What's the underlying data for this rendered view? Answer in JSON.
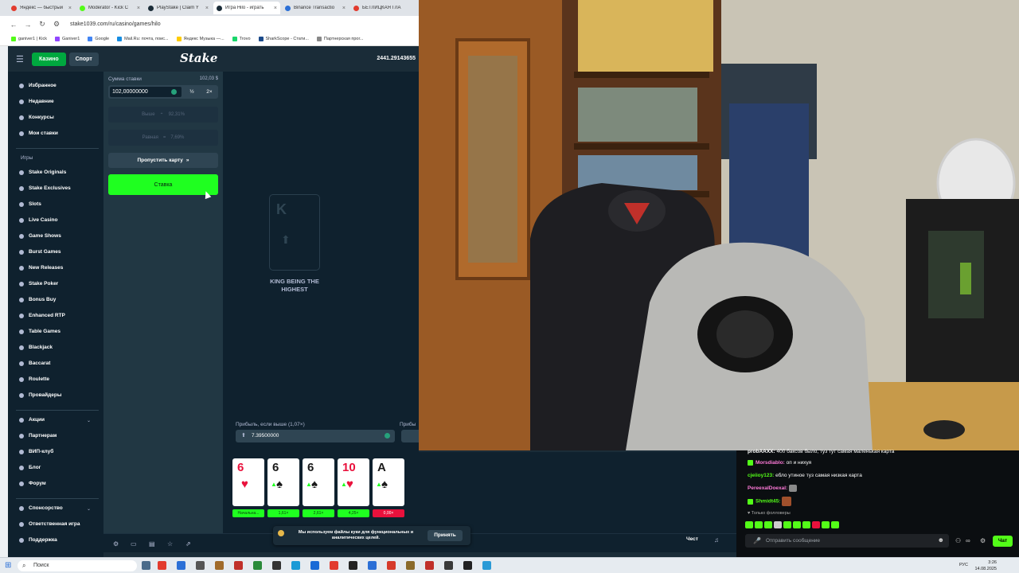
{
  "browser": {
    "tabs": [
      {
        "label": "Яндекс — быстрый",
        "color": "#e23b2e"
      },
      {
        "label": "Moderator - Kick C",
        "color": "#53fc18"
      },
      {
        "label": "PlayStake | Claim Y",
        "color": "#1a2c38"
      },
      {
        "label": "Игра Hilo - играть",
        "color": "#1a2c38"
      },
      {
        "label": "Binance Transactio",
        "color": "#2b6fd6"
      },
      {
        "label": "БЕТЛИЦКАЯ ГЛА",
        "color": "#e23b2e"
      }
    ],
    "url": "stake1039.com/ru/casino/games/hilo",
    "bookmarks": [
      "ganiver1 | Kick",
      "Ganiver1",
      "Google",
      "Mail.Ru: почта, поис...",
      "Яндекс Музыка —...",
      "Trovo",
      "SharkScope - Стати...",
      "Партнерская прог..."
    ]
  },
  "header": {
    "casino": "Казино",
    "sport": "Спорт",
    "logo": "Stake",
    "balance": "2441.29143655"
  },
  "sidebar": {
    "top_items": [
      "Избранное",
      "Недавние",
      "Конкурсы",
      "Мои ставки"
    ],
    "games_title": "Игры",
    "game_items": [
      "Stake Originals",
      "Stake Exclusives",
      "Slots",
      "Live Casino",
      "Game Shows",
      "Burst Games",
      "New Releases",
      "Stake Poker",
      "Bonus Buy",
      "Enhanced RTP",
      "Table Games",
      "Blackjack",
      "Baccarat",
      "Roulette",
      "Провайдеры"
    ],
    "bottom_items": [
      "Акции",
      "Партнерам",
      "ВИП-клуб",
      "Блог",
      "Форум"
    ],
    "extra_items": [
      "Спонсорство",
      "Ответственная игра",
      "Поддержка"
    ]
  },
  "bet": {
    "label": "Сумма ставки",
    "usd": "102,03 $",
    "amount": "102,00000000",
    "half": "½",
    "double": "2×",
    "higher_label": "Выше",
    "higher_pct": "92,31%",
    "equal_label": "Равная",
    "equal_pct": "7,69%",
    "skip": "Пропустить карту",
    "place": "Ставка"
  },
  "game": {
    "hint_rank": "K",
    "hint_text": "KING BEING THE HIGHEST",
    "profit_label": "Прибыль, если выше (1,07×)",
    "profit_label2": "Прибы",
    "profit_value": "7.39500000"
  },
  "cards": [
    {
      "rank": "6",
      "suit": "♥",
      "color": "#e9113c",
      "label": "Начальна...",
      "label_bg": "#1fff20"
    },
    {
      "rank": "6",
      "suit": "♠",
      "color": "#1a1a1a",
      "label": "1,61×",
      "label_bg": "#1fff20"
    },
    {
      "rank": "6",
      "suit": "♠",
      "color": "#1a1a1a",
      "label": "2,61×",
      "label_bg": "#1fff20"
    },
    {
      "rank": "10",
      "suit": "♥",
      "color": "#e9113c",
      "label": "4,25×",
      "label_bg": "#1fff20"
    },
    {
      "rank": "A",
      "suit": "♠",
      "color": "#1a1a1a",
      "label": "0,00×",
      "label_bg": "#e9113c"
    }
  ],
  "cookie": {
    "text": "Мы используем файлы куки для функциональных и аналитических целей.",
    "accept": "Принять"
  },
  "fair": "Чест",
  "chat": {
    "messages": [
      {
        "user": "probAAXX:",
        "text": "400 баксов было, туз тут самая маленькая карта",
        "color": "#ffffff"
      },
      {
        "user": "Morsdiablo:",
        "text": "оп и нихуя",
        "color": "#ff7ad9"
      },
      {
        "user": "cjeiioy123:",
        "text": "еблo утиное туз самая низкая карта",
        "color": "#53fc18"
      },
      {
        "user": "PereexalDoexal:",
        "text": "",
        "color": "#ff7ad9"
      },
      {
        "user": "Shmidt45:",
        "text": "",
        "color": "#53fc18"
      }
    ],
    "only_followers": "Только фолловеры",
    "input_placeholder": "Отправить сообщение",
    "send": "Чат"
  },
  "taskbar": {
    "search": "Поиск",
    "lang": "РУС",
    "time": "3:26",
    "date": "14.08.2025"
  }
}
